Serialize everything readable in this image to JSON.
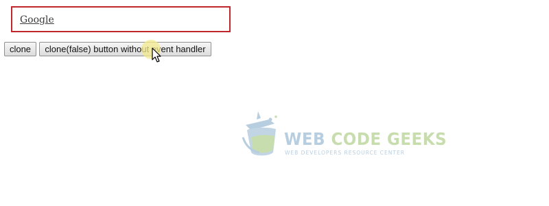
{
  "link": {
    "label": "Google"
  },
  "buttons": {
    "clone_label": "clone",
    "clone_false_label": "clone(false) button without event handler"
  },
  "watermark": {
    "title_part1": "WEB ",
    "title_part2": "CODE GEEKS",
    "subtitle": "WEB DEVELOPERS RESOURCE CENTER",
    "colors": {
      "blue": "#7ea7c8",
      "green": "#9cc36c"
    }
  },
  "colors": {
    "box_border": "#c0272d",
    "cursor_highlight": "#f3ea8c"
  }
}
